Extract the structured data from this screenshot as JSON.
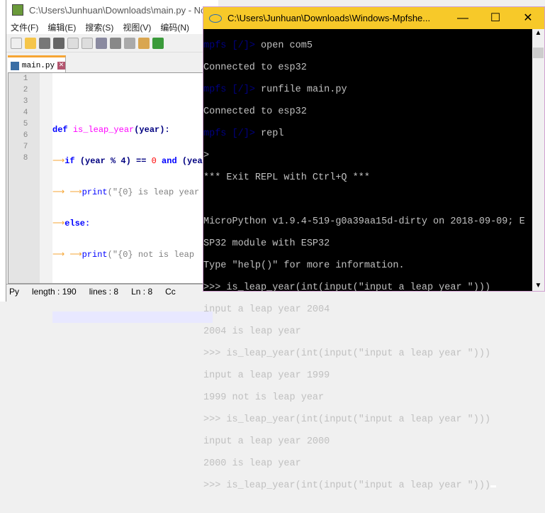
{
  "npp": {
    "title": "C:\\Users\\Junhuan\\Downloads\\main.py - No",
    "menu": [
      "文件(F)",
      "编辑(E)",
      "搜索(S)",
      "视图(V)",
      "编码(N)"
    ],
    "tab": "main.py",
    "lines": [
      "1",
      "2",
      "3",
      "4",
      "5",
      "6",
      "7",
      "8"
    ],
    "code": {
      "l2a": "def",
      "l2b": "is_leap_year",
      "l2c": "(year):",
      "l3a": "if",
      "l3b": "(year % 4) == ",
      "l3c": "0",
      "l3d": "and",
      "l3e": " (yea",
      "l4a": "print",
      "l4b": "(\"{0} is leap year",
      "l5a": "else:",
      "l6a": "print",
      "l6b": "(\"{0} not is leap"
    },
    "status": {
      "type": "Py",
      "length": "length : 190",
      "lines": "lines : 8",
      "ln": "Ln : 8",
      "col": "Cc"
    }
  },
  "console": {
    "title": "C:\\Users\\Junhuan\\Downloads\\Windows-Mpfshe...",
    "prompt_a": "mpfs ",
    "prompt_b": "[/]",
    "prompt_c": "> ",
    "cmds": [
      "open com5",
      "runfile main.py",
      "repl"
    ],
    "lines": [
      "Connected to esp32",
      "Connected to esp32",
      ">",
      "*** Exit REPL with Ctrl+Q ***",
      "",
      "MicroPython v1.9.4-519-g0a39aa15d-dirty on 2018-09-09; E",
      "SP32 module with ESP32",
      "Type \"help()\" for more information.",
      ">>> is_leap_year(int(input(\"input a leap year \")))",
      "input a leap year 2004",
      "2004 is leap year",
      ">>> is_leap_year(int(input(\"input a leap year \")))",
      "input a leap year 1999",
      "1999 not is leap year",
      ">>> is_leap_year(int(input(\"input a leap year \")))",
      "input a leap year 2000",
      "2000 is leap year",
      ">>> is_leap_year(int(input(\"input a leap year \")))"
    ],
    "buttons": {
      "min": "—",
      "max": "☐",
      "close": "✕"
    }
  }
}
